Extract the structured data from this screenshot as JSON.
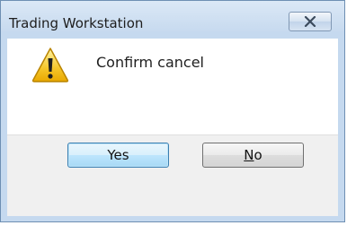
{
  "window": {
    "title": "Trading Workstation"
  },
  "dialog": {
    "message": "Confirm cancel",
    "icon": "warning-icon"
  },
  "buttons": {
    "yes_label": "Yes",
    "no_label_accel": "N",
    "no_label_rest": "o"
  },
  "colors": {
    "titlebar": "#c7daef",
    "footer": "#f0f0f0",
    "default_button_border": "#3c7fb1"
  }
}
